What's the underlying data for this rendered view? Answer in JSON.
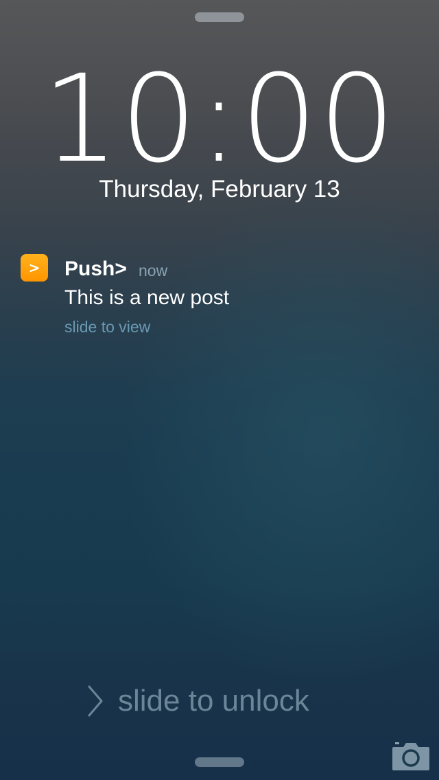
{
  "lockscreen": {
    "time": "10:00",
    "date": "Thursday, February 13"
  },
  "notification": {
    "app_icon_glyph": ">",
    "app_icon_color": "#ff9500",
    "app_name": "Push>",
    "time_ago": "now",
    "message": "This is a new post",
    "action_hint": "slide to view"
  },
  "unlock": {
    "label": "slide to unlock",
    "chevron_icon": "chevron-right-icon"
  },
  "camera": {
    "icon": "camera-icon"
  }
}
